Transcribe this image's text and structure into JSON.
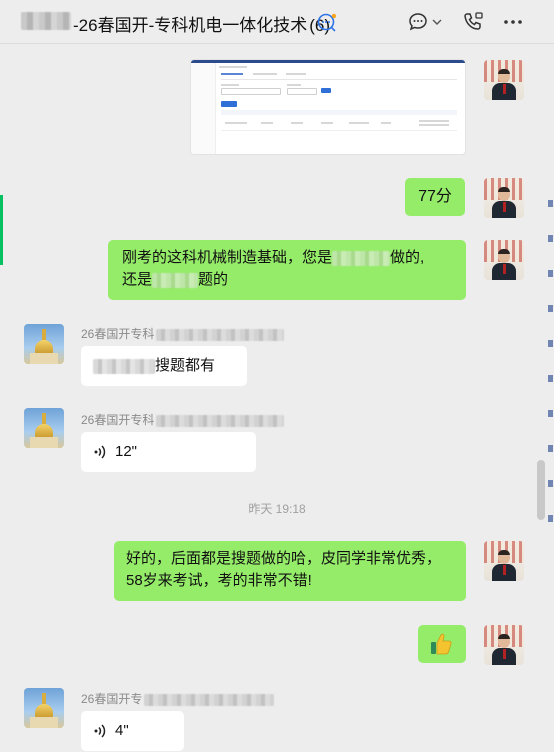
{
  "header": {
    "title": "-26春国开-专科机电一体化技术",
    "member_count": "(6)",
    "icons": [
      "group-chat-icon",
      "chat-more-icon",
      "dropdown-chevron-icon",
      "call-icon",
      "more-icon"
    ]
  },
  "messages": {
    "m1": {
      "type": "image",
      "sender": "me"
    },
    "m2": {
      "sender": "me",
      "text": "77分"
    },
    "m3": {
      "sender": "me",
      "line1_a": "刚考的这科机械制造基础，您是",
      "line1_b": "做的,",
      "line2_a": "还是",
      "line2_b": "题的"
    },
    "m4": {
      "sender": "other",
      "nickname": "26春国开专科",
      "text_b": "搜题都有"
    },
    "m5": {
      "sender": "other",
      "nickname": "26春国开专科",
      "duration": "12\""
    },
    "timestamp": "昨天 19:18",
    "m6": {
      "sender": "me",
      "line1": "好的，后面都是搜题做的哈，皮同学非常优秀，",
      "line2": "58岁来考试，考的非常不错!"
    },
    "m7": {
      "sender": "me",
      "emoji": "thumbs-up"
    },
    "m8": {
      "sender": "other",
      "nickname": "26春国开专",
      "duration": "4\""
    }
  },
  "colors": {
    "my_bubble": "#95ec69",
    "other_bubble": "#ffffff",
    "chat_bg": "#ededed",
    "accent_green": "#07c160"
  }
}
